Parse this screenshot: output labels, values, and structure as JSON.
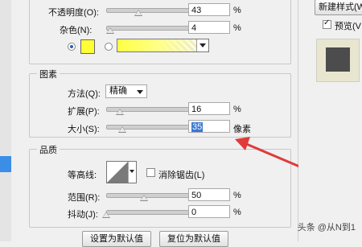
{
  "structure": {
    "opacity": {
      "label": "不透明度(O):",
      "value": "43",
      "unit": "%"
    },
    "noise": {
      "label": "杂色(N):",
      "value": "4",
      "unit": "%"
    },
    "color_swatch": "#ffff33"
  },
  "elements": {
    "legend": "图素",
    "technique": {
      "label": "方法(Q):",
      "value": "精确"
    },
    "spread": {
      "label": "扩展(P):",
      "value": "16",
      "unit": "%"
    },
    "size": {
      "label": "大小(S):",
      "value": "35",
      "unit": "像素"
    }
  },
  "quality": {
    "legend": "品质",
    "contour_label": "等高线:",
    "antialias_label": "消除锯齿(L)",
    "range": {
      "label": "范围(R):",
      "value": "50",
      "unit": "%"
    },
    "jitter": {
      "label": "抖动(J):",
      "value": "0",
      "unit": "%"
    }
  },
  "footer": {
    "make_default": "设置为默认值",
    "reset_default": "复位为默认值"
  },
  "right": {
    "new_style": "新建样式(W",
    "preview_label": "预览(V"
  },
  "watermark": "头条 @从N到1",
  "colors": {
    "accent_arrow": "#e03a3a",
    "selected_text_bg": "#3a78d4"
  }
}
